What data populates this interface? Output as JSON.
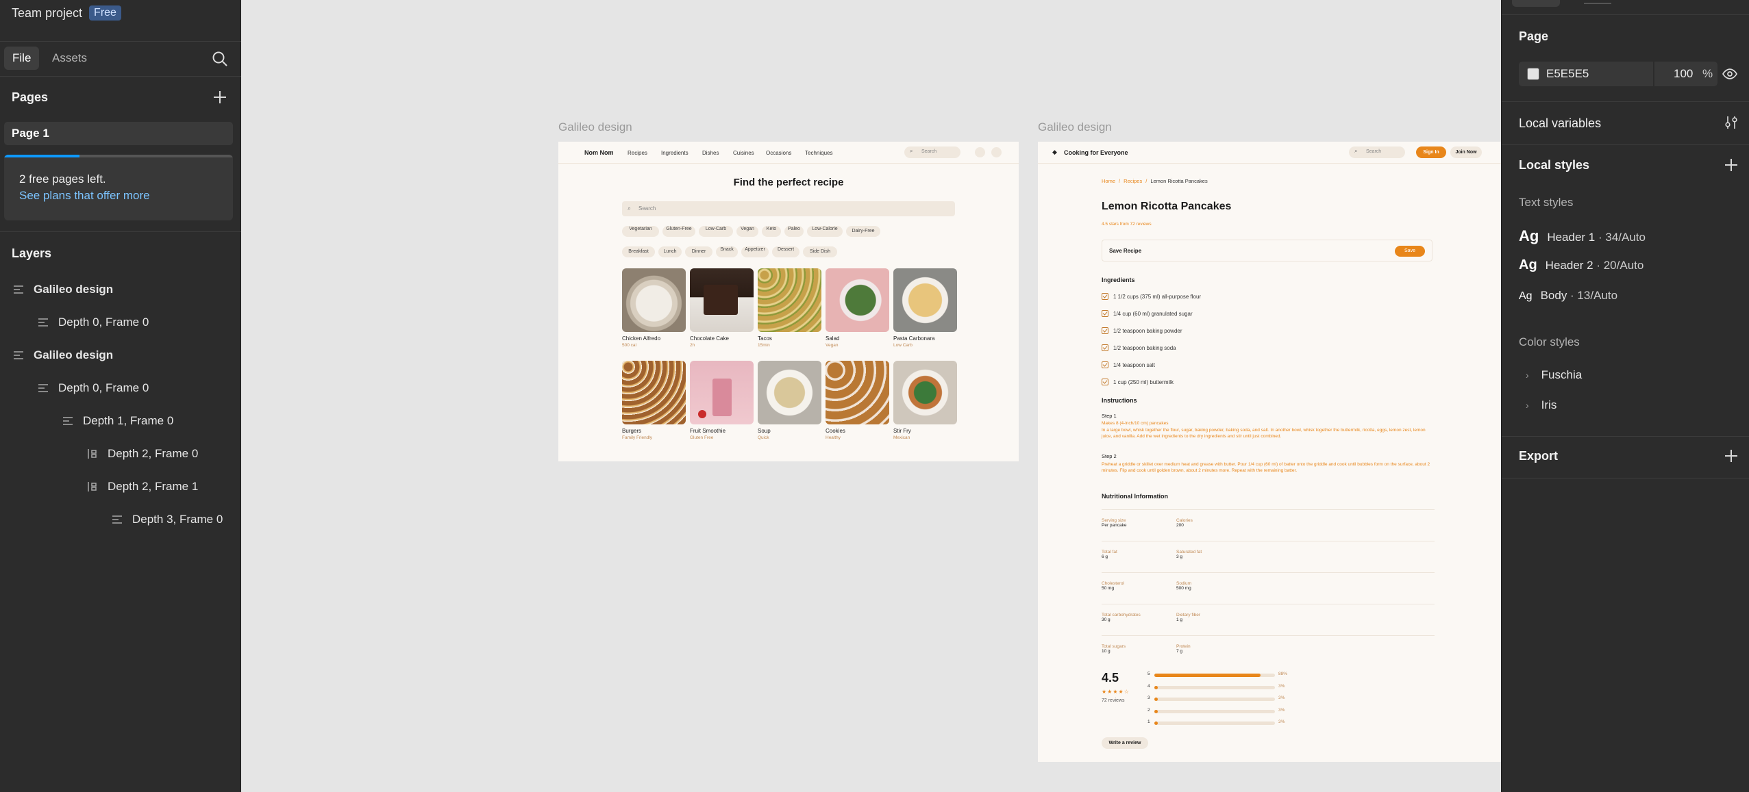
{
  "left_panel": {
    "team_name": "Team project",
    "plan_badge": "Free",
    "tabs": [
      "File",
      "Assets"
    ],
    "pages_title": "Pages",
    "current_page": "Page 1",
    "upsell": {
      "line1": "2 free pages left.",
      "link": "See plans that offer more",
      "progress": 0.33
    },
    "layers_title": "Layers",
    "layers": [
      {
        "label": "Galileo design",
        "depth": 0
      },
      {
        "label": "Depth 0, Frame 0",
        "depth": 1
      },
      {
        "label": "Galileo design",
        "depth": 0
      },
      {
        "label": "Depth 0, Frame 0",
        "depth": 1
      },
      {
        "label": "Depth 1, Frame 0",
        "depth": 2
      },
      {
        "label": "Depth 2, Frame 0",
        "depth": 3
      },
      {
        "label": "Depth 2, Frame 1",
        "depth": 3
      },
      {
        "label": "Depth 3, Frame 0",
        "depth": 4
      }
    ]
  },
  "right_panel": {
    "page_title": "Page",
    "page_color": "E5E5E5",
    "page_opacity": "100",
    "opacity_unit": "%",
    "local_variables": "Local variables",
    "local_styles": "Local styles",
    "text_styles_title": "Text styles",
    "text_styles": [
      {
        "ag": "Ag",
        "name": "Header 1",
        "meta": " · 34/Auto"
      },
      {
        "ag": "Ag",
        "name": "Header 2",
        "meta": " · 20/Auto"
      },
      {
        "ag": "Ag",
        "name": "Body",
        "meta": " · 13/Auto"
      }
    ],
    "color_styles_title": "Color styles",
    "color_styles": [
      "Fuschia",
      "Iris"
    ],
    "export": "Export"
  },
  "canvas": {
    "frame1": {
      "label": "Galileo design",
      "brand": "Nom Nom",
      "nav": [
        "Recipes",
        "Ingredients",
        "Dishes",
        "Cuisines",
        "Occasions",
        "Techniques"
      ],
      "search": "Search",
      "heading": "Find the perfect recipe",
      "main_search": "Search",
      "filters1": [
        "Vegetarian",
        "Gluten-Free",
        "Low-Carb",
        "Vegan",
        "Keto",
        "Paleo",
        "Low-Calorie",
        "Dairy-Free"
      ],
      "filters2": [
        "Breakfast",
        "Lunch",
        "Dinner",
        "Snack",
        "Appetizer",
        "Dessert",
        "Side Dish"
      ],
      "cards": [
        {
          "title": "Chicken Alfredo",
          "sub": "500 cal"
        },
        {
          "title": "Chocolate Cake",
          "sub": "2h"
        },
        {
          "title": "Tacos",
          "sub": "15min"
        },
        {
          "title": "Salad",
          "sub": "Vegan"
        },
        {
          "title": "Pasta Carbonara",
          "sub": "Low Carb"
        },
        {
          "title": "Burgers",
          "sub": "Family Friendly"
        },
        {
          "title": "Fruit Smoothie",
          "sub": "Gluten Free"
        },
        {
          "title": "Soup",
          "sub": "Quick"
        },
        {
          "title": "Cookies",
          "sub": "Healthy"
        },
        {
          "title": "Stir Fry",
          "sub": "Mexican"
        }
      ]
    },
    "frame2": {
      "label": "Galileo design",
      "brand": "Cooking for Everyone",
      "search": "Search",
      "sign_in": "Sign In",
      "join": "Join Now",
      "breadcrumb": [
        "Home",
        "Recipes",
        "Lemon Ricotta Pancakes"
      ],
      "title": "Lemon Ricotta Pancakes",
      "rating_line": "4.5 stars from 72 reviews",
      "save_recipe": "Save Recipe",
      "save": "Save",
      "ingredients_title": "Ingredients",
      "ingredients": [
        "1 1/2 cups (375 ml) all-purpose flour",
        "1/4 cup (60 ml) granulated sugar",
        "1/2 teaspoon baking powder",
        "1/2 teaspoon baking soda",
        "1/4 teaspoon salt",
        "1 cup (250 ml) buttermilk"
      ],
      "instructions_title": "Instructions",
      "step1_title": "Step 1",
      "step1_sub": "Makes 8 (4-inch/10 cm) pancakes",
      "step1_text": "In a large bowl, whisk together the flour, sugar, baking powder, baking soda, and salt. In another bowl, whisk together the buttermilk, ricotta, eggs, lemon zest, lemon juice, and vanilla. Add the wet ingredients to the dry ingredients and stir until just combined.",
      "step2_title": "Step 2",
      "step2_text": "Preheat a griddle or skillet over medium heat and grease with butter. Pour 1/4 cup (60 ml) of batter onto the griddle and cook until bubbles form on the surface, about 2 minutes. Flip and cook until golden brown, about 2 minutes more. Repeat with the remaining batter.",
      "nutrition_title": "Nutritional Information",
      "nutrition": [
        {
          "l1": "Serving size",
          "v1": "Per pancake",
          "l2": "Calories",
          "v2": "200"
        },
        {
          "l1": "Total fat",
          "v1": "6 g",
          "l2": "Saturated fat",
          "v2": "3 g"
        },
        {
          "l1": "Cholesterol",
          "v1": "50 mg",
          "l2": "Sodium",
          "v2": "500 mg"
        },
        {
          "l1": "Total carbohydrates",
          "v1": "30 g",
          "l2": "Dietary fiber",
          "v2": "1 g"
        },
        {
          "l1": "Total sugars",
          "v1": "10 g",
          "l2": "Protein",
          "v2": "7 g"
        }
      ],
      "rating": "4.5",
      "stars": "★★★★☆",
      "reviews": "72 reviews",
      "rating_bars": [
        {
          "star": "5",
          "pct": 0.88,
          "label": "88%"
        },
        {
          "star": "4",
          "pct": 0.03,
          "label": "3%"
        },
        {
          "star": "3",
          "pct": 0.03,
          "label": "3%"
        },
        {
          "star": "2",
          "pct": 0.03,
          "label": "3%"
        },
        {
          "star": "1",
          "pct": 0.03,
          "label": "3%"
        }
      ],
      "write_review": "Write a review"
    }
  }
}
